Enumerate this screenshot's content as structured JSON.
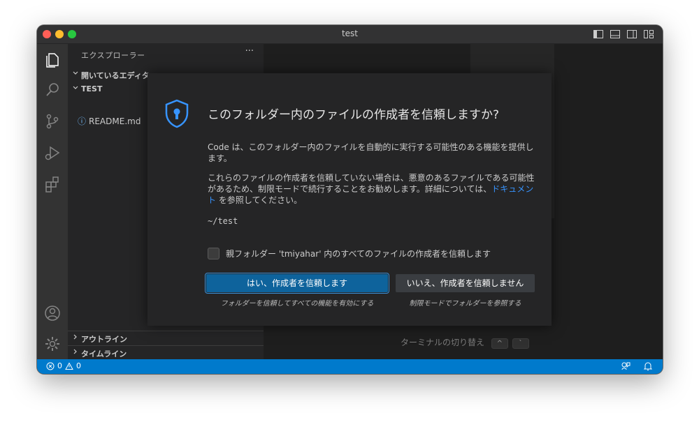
{
  "window": {
    "title": "test"
  },
  "sidebar": {
    "title": "エクスプローラー",
    "more": "···",
    "open_editors": "開いているエディター",
    "folder": "TEST",
    "files": [
      {
        "name": "README.md"
      }
    ],
    "outline": "アウトライン",
    "timeline": "タイムライン"
  },
  "editor": {
    "terminal_hint": "ターミナルの切り替え",
    "kbd1": "^",
    "kbd2": "`"
  },
  "dialog": {
    "title": "このフォルダー内のファイルの作成者を信頼しますか?",
    "para1": "Code は、このフォルダー内のファイルを自動的に実行する可能性のある機能を提供します。",
    "para2_pre": "これらのファイルの作成者を信頼していない場合は、悪意のあるファイルである可能性があるため、制限モードで続行することをお勧めします。詳細については、",
    "para2_link": "ドキュメント",
    "para2_post": " を参照してください。",
    "path": "~/test",
    "checkbox_label": "親フォルダー 'tmiyahar' 内のすべてのファイルの作成者を信頼します",
    "trust_button": "はい、作成者を信頼します",
    "trust_sub": "フォルダーを信頼してすべての機能を有効にする",
    "distrust_button": "いいえ、作成者を信頼しません",
    "distrust_sub": "制限モードでフォルダーを参照する"
  },
  "status": {
    "errors": "0",
    "warnings": "0"
  },
  "colors": {
    "accent": "#007acc",
    "button": "#0e639c",
    "link": "#3794ff"
  }
}
